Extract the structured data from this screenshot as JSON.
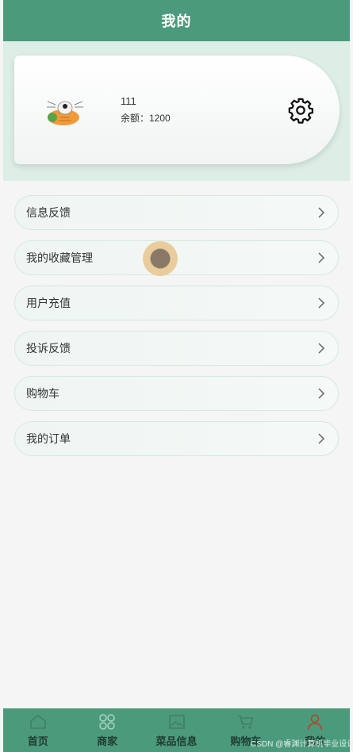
{
  "header": {
    "title": "我的"
  },
  "profile": {
    "username": "111",
    "balance_text": "余额：1200",
    "settings_icon": "gear-icon"
  },
  "menu": {
    "items": [
      {
        "label": "信息反馈"
      },
      {
        "label": "我的收藏管理"
      },
      {
        "label": "用户充值"
      },
      {
        "label": "投诉反馈"
      },
      {
        "label": "购物车"
      },
      {
        "label": "我的订单"
      }
    ]
  },
  "tabbar": {
    "items": [
      {
        "label": "首页",
        "icon": "home-icon"
      },
      {
        "label": "商家",
        "icon": "grid-icon"
      },
      {
        "label": "菜品信息",
        "icon": "image-icon"
      },
      {
        "label": "购物车",
        "icon": "cart-icon"
      },
      {
        "label": "我的",
        "icon": "user-icon"
      }
    ]
  },
  "watermark": "CSDN @睿渊计算机毕业设计",
  "colors": {
    "primary": "#4c9a7c",
    "header_bg": "#dceee6",
    "active_icon": "#c0402b"
  }
}
